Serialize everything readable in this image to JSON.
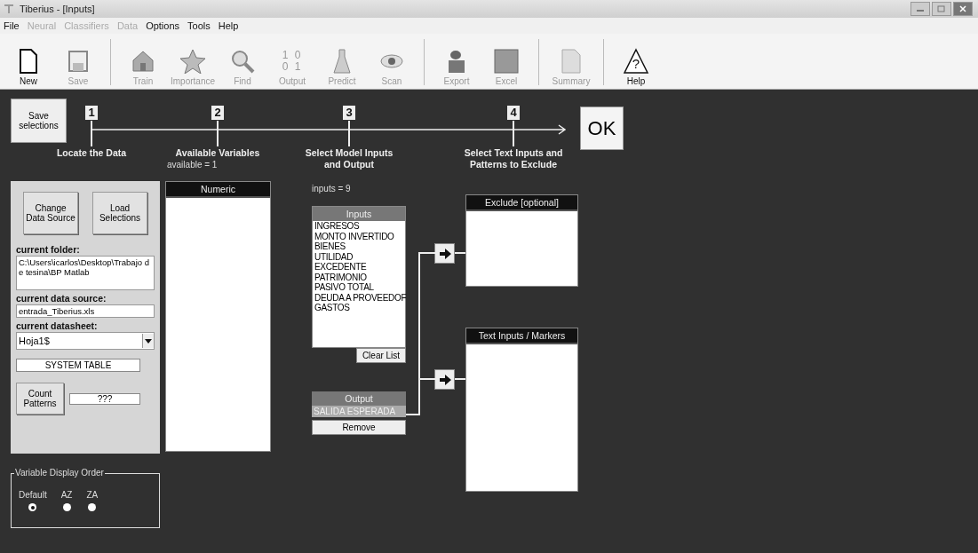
{
  "window": {
    "title": "Tiberius - [Inputs]"
  },
  "menu": [
    {
      "label": "File",
      "disabled": false
    },
    {
      "label": "Neural",
      "disabled": true
    },
    {
      "label": "Classifiers",
      "disabled": true
    },
    {
      "label": "Data",
      "disabled": true
    },
    {
      "label": "Options",
      "disabled": false
    },
    {
      "label": "Tools",
      "disabled": false
    },
    {
      "label": "Help",
      "disabled": false
    }
  ],
  "toolbar": [
    {
      "kind": "new",
      "label": "New",
      "disabled": false,
      "separator_after": false
    },
    {
      "kind": "save",
      "label": "Save",
      "disabled": true,
      "separator_after": true
    },
    {
      "kind": "train",
      "label": "Train",
      "disabled": true,
      "separator_after": false
    },
    {
      "kind": "importance",
      "label": "Importance",
      "disabled": true,
      "separator_after": false
    },
    {
      "kind": "find",
      "label": "Find",
      "disabled": true,
      "separator_after": false
    },
    {
      "kind": "output",
      "label": "Output",
      "disabled": true,
      "separator_after": false,
      "glyph_lines": [
        "1 0",
        "0 1"
      ]
    },
    {
      "kind": "predict",
      "label": "Predict",
      "disabled": true,
      "separator_after": false
    },
    {
      "kind": "scan",
      "label": "Scan",
      "disabled": true,
      "separator_after": true
    },
    {
      "kind": "export",
      "label": "Export",
      "disabled": true,
      "separator_after": false
    },
    {
      "kind": "excel",
      "label": "Excel",
      "disabled": true,
      "separator_after": true
    },
    {
      "kind": "summary",
      "label": "Summary",
      "disabled": true,
      "separator_after": true
    },
    {
      "kind": "help",
      "label": "Help",
      "disabled": false,
      "separator_after": false,
      "glyph": "?"
    }
  ],
  "save_button": "Save selections",
  "steps": [
    {
      "number": "1",
      "label": "Locate the Data"
    },
    {
      "number": "2",
      "label": "Available Variables"
    },
    {
      "number": "3",
      "label": "Select Model Inputs and Output"
    },
    {
      "number": "4",
      "label": "Select Text Inputs and Patterns to Exclude"
    }
  ],
  "ok_button": "OK",
  "available_count": "available = 1",
  "data_panel": {
    "change_button": "Change Data Source",
    "load_button": "Load Selections",
    "folder_label": "current folder:",
    "folder_value": "C:\\Users\\icarlos\\Desktop\\Trabajo de tesina\\BP Matlab",
    "source_label": "current data source:",
    "source_value": "entrada_Tiberius.xls",
    "sheet_label": "current datasheet:",
    "sheet_value": "Hoja1$",
    "system_table": "SYSTEM TABLE",
    "count_button": "Count Patterns",
    "count_value": "???"
  },
  "numeric_list": {
    "header": "Numeric"
  },
  "inputs_count": "inputs = 9",
  "inputs_list": {
    "header": "Inputs",
    "items": [
      "INGRESOS",
      "MONTO INVERTIDO",
      "BIENES",
      "UTILIDAD",
      "EXCEDENTE",
      "PATRIMONIO",
      "PASIVO TOTAL",
      "DEUDA A PROVEEDOF",
      "GASTOS"
    ]
  },
  "clear_button": "Clear List",
  "output_list": {
    "header": "Output",
    "items": [
      {
        "label": "SALIDA ESPERADA",
        "selected": true
      }
    ]
  },
  "remove_button": "Remove",
  "exclude_list": {
    "header": "Exclude [optional]"
  },
  "text_inputs_list": {
    "header": "Text Inputs / Markers"
  },
  "display_order": {
    "title": "Variable Display Order",
    "options": [
      {
        "label": "Default",
        "selected": true
      },
      {
        "label": "AZ",
        "selected": false
      },
      {
        "label": "ZA",
        "selected": false
      }
    ]
  }
}
